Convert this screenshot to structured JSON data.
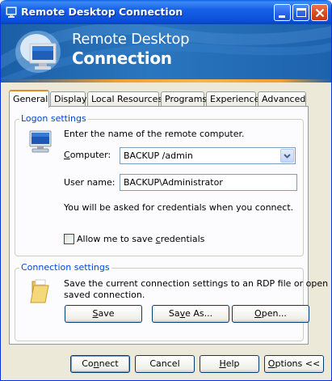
{
  "window": {
    "title": "Remote Desktop Connection"
  },
  "banner": {
    "line1": "Remote Desktop",
    "line2": "Connection"
  },
  "tabs": [
    {
      "label": "General",
      "active": true
    },
    {
      "label": "Display",
      "active": false
    },
    {
      "label": "Local Resources",
      "active": false
    },
    {
      "label": "Programs",
      "active": false
    },
    {
      "label": "Experience",
      "active": false
    },
    {
      "label": "Advanced",
      "active": false
    }
  ],
  "logon": {
    "group_label": "Logon settings",
    "instruction": "Enter the name of the remote computer.",
    "computer_label": "Computer:",
    "computer_value": "BACKUP /admin",
    "username_label": "User name:",
    "username_value": "BACKUP\\Administrator",
    "credentials_note": "You will be asked for credentials when you connect.",
    "save_credentials_label": "Allow me to save credentials",
    "save_credentials_checked": false
  },
  "connection": {
    "group_label": "Connection settings",
    "description_line1": "Save the current connection settings to an RDP file or open a",
    "description_line2": "saved connection.",
    "save_label": "Save",
    "save_as_label": "Save As...",
    "open_label": "Open..."
  },
  "footer": {
    "connect_label": "Connect",
    "cancel_label": "Cancel",
    "help_label": "Help",
    "options_label": "Options <<"
  },
  "icons": [
    "rdc-app-icon",
    "minimize-icon",
    "maximize-icon",
    "close-icon",
    "monitor-icon",
    "chevron-down-icon",
    "folder-icon"
  ],
  "colors": {
    "title_bar": "#0a4ed6",
    "banner": "#2a76bf",
    "accent_orange": "#f0a030",
    "group_label": "#0046d5"
  }
}
